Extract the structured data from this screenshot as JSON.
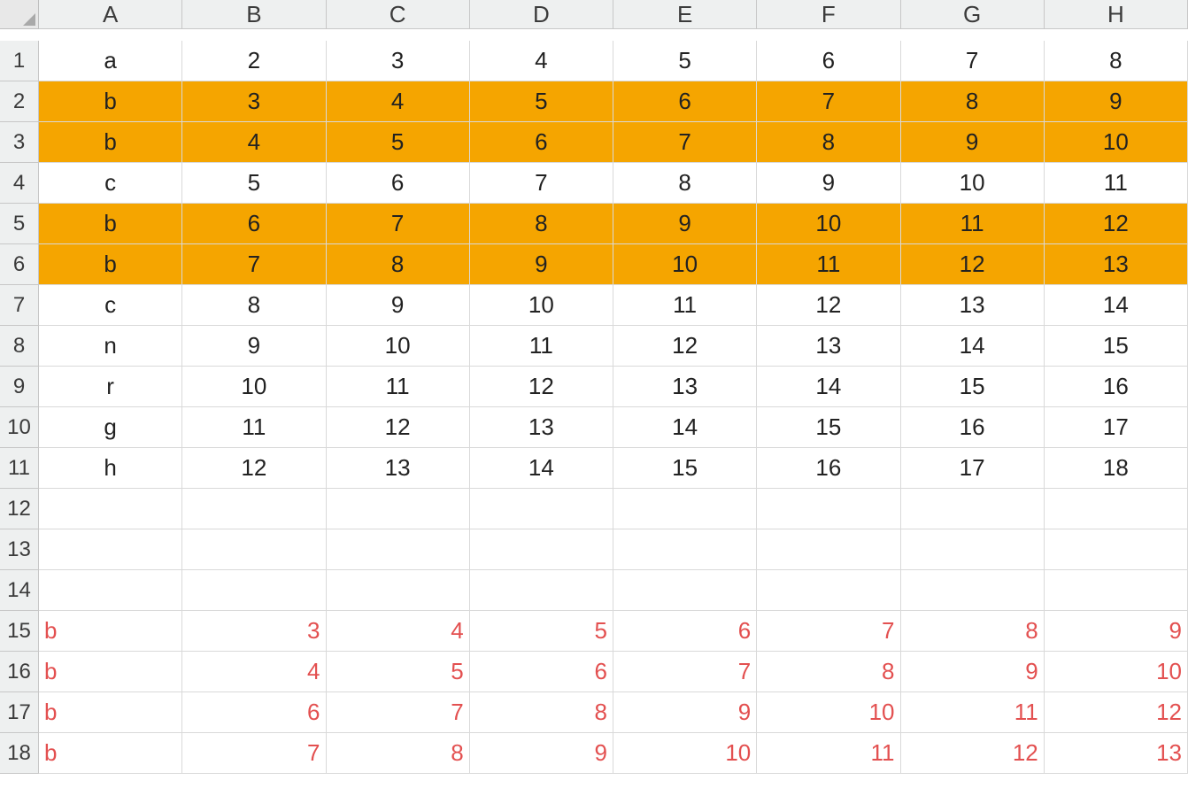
{
  "columns": [
    "A",
    "B",
    "C",
    "D",
    "E",
    "F",
    "G",
    "H"
  ],
  "rows": [
    {
      "n": "1",
      "hl": false,
      "cells": [
        {
          "v": "a",
          "a": "center"
        },
        {
          "v": "2",
          "a": "center"
        },
        {
          "v": "3",
          "a": "center"
        },
        {
          "v": "4",
          "a": "center"
        },
        {
          "v": "5",
          "a": "center"
        },
        {
          "v": "6",
          "a": "center"
        },
        {
          "v": "7",
          "a": "center"
        },
        {
          "v": "8",
          "a": "center"
        }
      ]
    },
    {
      "n": "2",
      "hl": true,
      "cells": [
        {
          "v": "b",
          "a": "center"
        },
        {
          "v": "3",
          "a": "center"
        },
        {
          "v": "4",
          "a": "center"
        },
        {
          "v": "5",
          "a": "center"
        },
        {
          "v": "6",
          "a": "center"
        },
        {
          "v": "7",
          "a": "center"
        },
        {
          "v": "8",
          "a": "center"
        },
        {
          "v": "9",
          "a": "center"
        }
      ]
    },
    {
      "n": "3",
      "hl": true,
      "cells": [
        {
          "v": "b",
          "a": "center"
        },
        {
          "v": "4",
          "a": "center"
        },
        {
          "v": "5",
          "a": "center"
        },
        {
          "v": "6",
          "a": "center"
        },
        {
          "v": "7",
          "a": "center"
        },
        {
          "v": "8",
          "a": "center"
        },
        {
          "v": "9",
          "a": "center"
        },
        {
          "v": "10",
          "a": "center"
        }
      ]
    },
    {
      "n": "4",
      "hl": false,
      "cells": [
        {
          "v": "c",
          "a": "center"
        },
        {
          "v": "5",
          "a": "center"
        },
        {
          "v": "6",
          "a": "center"
        },
        {
          "v": "7",
          "a": "center"
        },
        {
          "v": "8",
          "a": "center"
        },
        {
          "v": "9",
          "a": "center"
        },
        {
          "v": "10",
          "a": "center"
        },
        {
          "v": "11",
          "a": "center"
        }
      ]
    },
    {
      "n": "5",
      "hl": true,
      "cells": [
        {
          "v": "b",
          "a": "center"
        },
        {
          "v": "6",
          "a": "center"
        },
        {
          "v": "7",
          "a": "center"
        },
        {
          "v": "8",
          "a": "center"
        },
        {
          "v": "9",
          "a": "center"
        },
        {
          "v": "10",
          "a": "center"
        },
        {
          "v": "11",
          "a": "center"
        },
        {
          "v": "12",
          "a": "center"
        }
      ]
    },
    {
      "n": "6",
      "hl": true,
      "cells": [
        {
          "v": "b",
          "a": "center"
        },
        {
          "v": "7",
          "a": "center"
        },
        {
          "v": "8",
          "a": "center"
        },
        {
          "v": "9",
          "a": "center"
        },
        {
          "v": "10",
          "a": "center"
        },
        {
          "v": "11",
          "a": "center"
        },
        {
          "v": "12",
          "a": "center"
        },
        {
          "v": "13",
          "a": "center"
        }
      ]
    },
    {
      "n": "7",
      "hl": false,
      "cells": [
        {
          "v": "c",
          "a": "center"
        },
        {
          "v": "8",
          "a": "center"
        },
        {
          "v": "9",
          "a": "center"
        },
        {
          "v": "10",
          "a": "center"
        },
        {
          "v": "11",
          "a": "center"
        },
        {
          "v": "12",
          "a": "center"
        },
        {
          "v": "13",
          "a": "center"
        },
        {
          "v": "14",
          "a": "center"
        }
      ]
    },
    {
      "n": "8",
      "hl": false,
      "cells": [
        {
          "v": "n",
          "a": "center"
        },
        {
          "v": "9",
          "a": "center"
        },
        {
          "v": "10",
          "a": "center"
        },
        {
          "v": "11",
          "a": "center"
        },
        {
          "v": "12",
          "a": "center"
        },
        {
          "v": "13",
          "a": "center"
        },
        {
          "v": "14",
          "a": "center"
        },
        {
          "v": "15",
          "a": "center"
        }
      ]
    },
    {
      "n": "9",
      "hl": false,
      "cells": [
        {
          "v": "r",
          "a": "center"
        },
        {
          "v": "10",
          "a": "center"
        },
        {
          "v": "11",
          "a": "center"
        },
        {
          "v": "12",
          "a": "center"
        },
        {
          "v": "13",
          "a": "center"
        },
        {
          "v": "14",
          "a": "center"
        },
        {
          "v": "15",
          "a": "center"
        },
        {
          "v": "16",
          "a": "center"
        }
      ]
    },
    {
      "n": "10",
      "hl": false,
      "cells": [
        {
          "v": "g",
          "a": "center"
        },
        {
          "v": "11",
          "a": "center"
        },
        {
          "v": "12",
          "a": "center"
        },
        {
          "v": "13",
          "a": "center"
        },
        {
          "v": "14",
          "a": "center"
        },
        {
          "v": "15",
          "a": "center"
        },
        {
          "v": "16",
          "a": "center"
        },
        {
          "v": "17",
          "a": "center"
        }
      ]
    },
    {
      "n": "11",
      "hl": false,
      "cells": [
        {
          "v": "h",
          "a": "center"
        },
        {
          "v": "12",
          "a": "center"
        },
        {
          "v": "13",
          "a": "center"
        },
        {
          "v": "14",
          "a": "center"
        },
        {
          "v": "15",
          "a": "center"
        },
        {
          "v": "16",
          "a": "center"
        },
        {
          "v": "17",
          "a": "center"
        },
        {
          "v": "18",
          "a": "center"
        }
      ]
    },
    {
      "n": "12",
      "hl": false,
      "cells": [
        {
          "v": "",
          "a": "center"
        },
        {
          "v": "",
          "a": "center"
        },
        {
          "v": "",
          "a": "center"
        },
        {
          "v": "",
          "a": "center"
        },
        {
          "v": "",
          "a": "center"
        },
        {
          "v": "",
          "a": "center"
        },
        {
          "v": "",
          "a": "center"
        },
        {
          "v": "",
          "a": "center"
        }
      ]
    },
    {
      "n": "13",
      "hl": false,
      "cells": [
        {
          "v": "",
          "a": "center"
        },
        {
          "v": "",
          "a": "center"
        },
        {
          "v": "",
          "a": "center"
        },
        {
          "v": "",
          "a": "center"
        },
        {
          "v": "",
          "a": "center"
        },
        {
          "v": "",
          "a": "center"
        },
        {
          "v": "",
          "a": "center"
        },
        {
          "v": "",
          "a": "center"
        }
      ]
    },
    {
      "n": "14",
      "hl": false,
      "cells": [
        {
          "v": "",
          "a": "center"
        },
        {
          "v": "",
          "a": "center"
        },
        {
          "v": "",
          "a": "center"
        },
        {
          "v": "",
          "a": "center"
        },
        {
          "v": "",
          "a": "center"
        },
        {
          "v": "",
          "a": "center"
        },
        {
          "v": "",
          "a": "center"
        },
        {
          "v": "",
          "a": "center"
        }
      ]
    },
    {
      "n": "15",
      "hl": false,
      "red": true,
      "cells": [
        {
          "v": "b",
          "a": "left"
        },
        {
          "v": "3",
          "a": "right"
        },
        {
          "v": "4",
          "a": "right"
        },
        {
          "v": "5",
          "a": "right"
        },
        {
          "v": "6",
          "a": "right"
        },
        {
          "v": "7",
          "a": "right"
        },
        {
          "v": "8",
          "a": "right"
        },
        {
          "v": "9",
          "a": "right"
        }
      ]
    },
    {
      "n": "16",
      "hl": false,
      "red": true,
      "cells": [
        {
          "v": "b",
          "a": "left"
        },
        {
          "v": "4",
          "a": "right"
        },
        {
          "v": "5",
          "a": "right"
        },
        {
          "v": "6",
          "a": "right"
        },
        {
          "v": "7",
          "a": "right"
        },
        {
          "v": "8",
          "a": "right"
        },
        {
          "v": "9",
          "a": "right"
        },
        {
          "v": "10",
          "a": "right"
        }
      ]
    },
    {
      "n": "17",
      "hl": false,
      "red": true,
      "cells": [
        {
          "v": "b",
          "a": "left"
        },
        {
          "v": "6",
          "a": "right"
        },
        {
          "v": "7",
          "a": "right"
        },
        {
          "v": "8",
          "a": "right"
        },
        {
          "v": "9",
          "a": "right"
        },
        {
          "v": "10",
          "a": "right"
        },
        {
          "v": "11",
          "a": "right"
        },
        {
          "v": "12",
          "a": "right"
        }
      ]
    },
    {
      "n": "18",
      "hl": false,
      "red": true,
      "cells": [
        {
          "v": "b",
          "a": "left"
        },
        {
          "v": "7",
          "a": "right"
        },
        {
          "v": "8",
          "a": "right"
        },
        {
          "v": "9",
          "a": "right"
        },
        {
          "v": "10",
          "a": "right"
        },
        {
          "v": "11",
          "a": "right"
        },
        {
          "v": "12",
          "a": "right"
        },
        {
          "v": "13",
          "a": "right"
        }
      ]
    }
  ],
  "chart_data": {
    "type": "table",
    "columns": [
      "A",
      "B",
      "C",
      "D",
      "E",
      "F",
      "G",
      "H"
    ],
    "rows": [
      [
        "a",
        2,
        3,
        4,
        5,
        6,
        7,
        8
      ],
      [
        "b",
        3,
        4,
        5,
        6,
        7,
        8,
        9
      ],
      [
        "b",
        4,
        5,
        6,
        7,
        8,
        9,
        10
      ],
      [
        "c",
        5,
        6,
        7,
        8,
        9,
        10,
        11
      ],
      [
        "b",
        6,
        7,
        8,
        9,
        10,
        11,
        12
      ],
      [
        "b",
        7,
        8,
        9,
        10,
        11,
        12,
        13
      ],
      [
        "c",
        8,
        9,
        10,
        11,
        12,
        13,
        14
      ],
      [
        "n",
        9,
        10,
        11,
        12,
        13,
        14,
        15
      ],
      [
        "r",
        10,
        11,
        12,
        13,
        14,
        15,
        16
      ],
      [
        "g",
        11,
        12,
        13,
        14,
        15,
        16,
        17
      ],
      [
        "h",
        12,
        13,
        14,
        15,
        16,
        17,
        18
      ],
      [
        null,
        null,
        null,
        null,
        null,
        null,
        null,
        null
      ],
      [
        null,
        null,
        null,
        null,
        null,
        null,
        null,
        null
      ],
      [
        null,
        null,
        null,
        null,
        null,
        null,
        null,
        null
      ],
      [
        "b",
        3,
        4,
        5,
        6,
        7,
        8,
        9
      ],
      [
        "b",
        4,
        5,
        6,
        7,
        8,
        9,
        10
      ],
      [
        "b",
        6,
        7,
        8,
        9,
        10,
        11,
        12
      ],
      [
        "b",
        7,
        8,
        9,
        10,
        11,
        12,
        13
      ]
    ],
    "highlighted_rows": [
      2,
      3,
      5,
      6
    ],
    "red_rows": [
      15,
      16,
      17,
      18
    ]
  }
}
